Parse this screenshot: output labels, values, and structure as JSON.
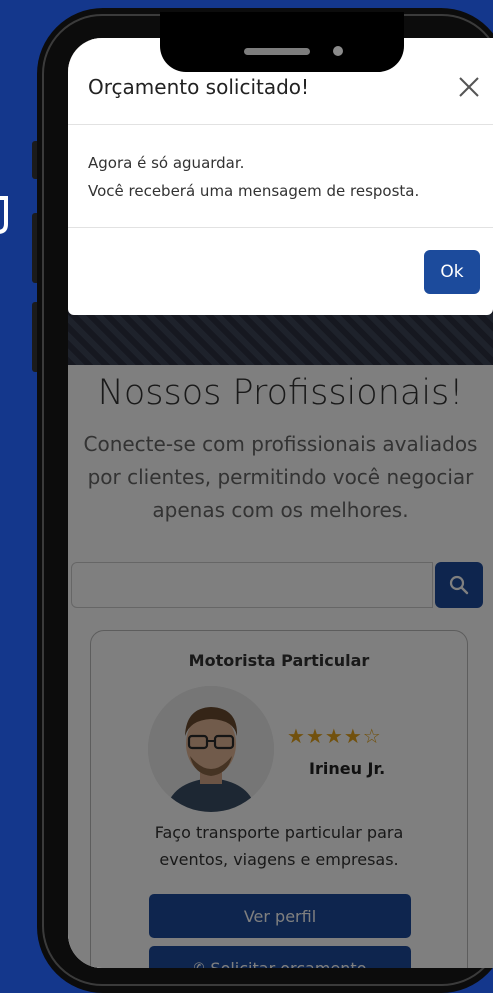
{
  "colors": {
    "background": "#14378c",
    "primary_button": "#1c4b9c",
    "star": "#e4a31a"
  },
  "page": {
    "section_title": "Nossos Profissionais!",
    "section_subtitle_lines": [
      "Conecte-se com profissionais avaliados",
      "por clientes, permitindo você negociar",
      "apenas com os melhores."
    ],
    "search": {
      "placeholder": "",
      "button_icon": "search-icon"
    }
  },
  "card": {
    "role": "Motorista Particular",
    "rating": 4,
    "rating_max": 5,
    "name": "Irineu Jr.",
    "description_lines": [
      "Faço transporte particular para",
      "eventos, viagens e empresas."
    ],
    "view_profile_label": "Ver perfil",
    "request_quote_label": "Solicitar orçamento",
    "request_quote_icon": "whatsapp-icon"
  },
  "modal": {
    "title": "Orçamento solicitado!",
    "close_icon": "close-icon",
    "body_lines": [
      "Agora é só aguardar.",
      "Você receberá uma mensagem de resposta."
    ],
    "ok_label": "Ok"
  }
}
